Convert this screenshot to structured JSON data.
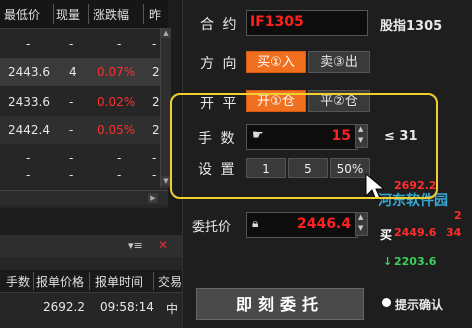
{
  "table": {
    "headers": [
      "最低价",
      "现量",
      "涨跌幅",
      "昨"
    ],
    "rows": [
      {
        "low": "-",
        "vol": "-",
        "chg": "-",
        "prev": "-"
      },
      {
        "low": "2443.6",
        "vol": "4",
        "chg": "0.07%",
        "prev": "2"
      },
      {
        "low": "2433.6",
        "vol": "-",
        "chg": "0.02%",
        "prev": "2"
      },
      {
        "low": "2442.4",
        "vol": "-",
        "chg": "0.05%",
        "prev": "2"
      },
      {
        "low": "-",
        "vol": "-",
        "chg": "-",
        "prev": "-"
      },
      {
        "low": "-",
        "vol": "-",
        "chg": "-",
        "prev": "-"
      }
    ]
  },
  "orders": {
    "headers": [
      "手数",
      "报单价格",
      "报单时间",
      "交易"
    ],
    "rows": [
      {
        "price": "2692.2",
        "time": "09:58:14",
        "extra": "中"
      }
    ],
    "menu_icon": "▾≡",
    "close_icon": "✕"
  },
  "form": {
    "contract_label": "合 约",
    "contract_value": "IF1305",
    "contract_name": "股指1305",
    "direction_label": "方 向",
    "buy_label": "买①入",
    "sell_label": "卖③出",
    "offset_label": "开 平",
    "open_label": "开①仓",
    "close_label": "平②仓",
    "qty_label": "手 数",
    "qty_value": "15",
    "qty_max": "≤ 31",
    "preset_label": "设 置",
    "preset_1": "1",
    "preset_5": "5",
    "preset_50": "50%",
    "price_label": "委托价",
    "price_value": "2446.4",
    "submit_label": "即刻委托",
    "confirm_label": "提示确认"
  },
  "quote": {
    "ask_price": "2692.2",
    "bid_label": "买",
    "bid_price": "2449.6",
    "bid_vol": "34",
    "last_price": "2203.6",
    "partial_2": "2"
  },
  "watermark": "河东软件园"
}
